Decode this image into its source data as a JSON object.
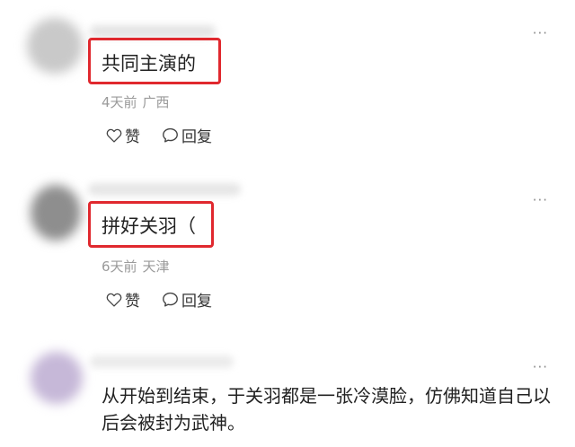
{
  "comments": [
    {
      "text": "共同主演的",
      "time": "4天前",
      "location": "广西",
      "like_label": "赞",
      "reply_label": "回复",
      "more_label": "···"
    },
    {
      "text": "拼好关羽（",
      "time": "6天前",
      "location": "天津",
      "like_label": "赞",
      "reply_label": "回复",
      "more_label": "···"
    },
    {
      "text": "从开始到结束，于关羽都是一张冷漠脸，仿佛知道自己以后会被封为武神。",
      "more_label": "···"
    }
  ],
  "icons": {
    "like": "heart-outline-icon",
    "reply": "speech-bubble-icon",
    "more": "more-dots-icon"
  },
  "colors": {
    "highlight": "#e0282e",
    "meta": "#9a9a9a",
    "text": "#222222"
  }
}
